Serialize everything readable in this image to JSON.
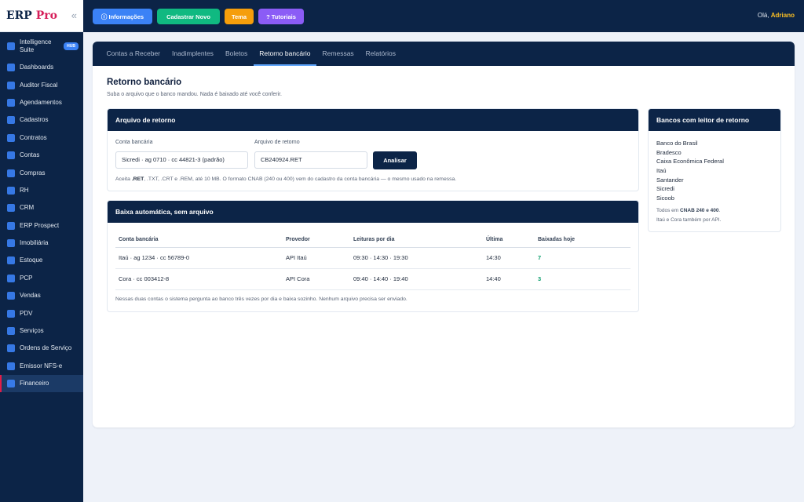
{
  "app": {
    "brand_main": "ERP",
    "brand_accent": "Pro",
    "collapse_icon": "«"
  },
  "sidebar": {
    "items": [
      {
        "label": "Intelligence Suite",
        "badge": "HUB"
      },
      {
        "label": "Dashboards"
      },
      {
        "label": "Auditor Fiscal"
      },
      {
        "label": "Agendamentos"
      },
      {
        "label": "Cadastros"
      },
      {
        "label": "Contratos"
      },
      {
        "label": "Contas"
      },
      {
        "label": "Compras"
      },
      {
        "label": "RH"
      },
      {
        "label": "CRM"
      },
      {
        "label": "ERP Prospect"
      },
      {
        "label": "Imobiliária"
      },
      {
        "label": "Estoque"
      },
      {
        "label": "PCP"
      },
      {
        "label": "Vendas"
      },
      {
        "label": "PDV"
      },
      {
        "label": "Serviços"
      },
      {
        "label": "Ordens de Serviço"
      },
      {
        "label": "Emissor NFS-e"
      },
      {
        "label": "Financeiro",
        "active": true
      }
    ]
  },
  "topbar": {
    "info": "ⓘ Informações",
    "new": "Cadastrar Novo",
    "theme": "Tema",
    "tutorials": "? Tutoriais",
    "greeting_prefix": "Olá,",
    "user": "Adriano"
  },
  "tabs": [
    "Contas a Receber",
    "Inadimplentes",
    "Boletos",
    "Retorno bancário",
    "Remessas",
    "Relatórios"
  ],
  "active_tab": "Retorno bancário",
  "page": {
    "title": "Retorno bancário",
    "subtitle": "Suba o arquivo que o banco mandou. Nada é baixado até você conferir."
  },
  "upload": {
    "header": "Arquivo de retorno",
    "account_label": "Conta bancária",
    "account_value": "Sicredi · ag 0710 · cc 44821-3  (padrão)",
    "file_label": "Arquivo de retorno",
    "file_value": "CB240924.RET",
    "analyze_button": "Analisar",
    "hint_prefix": "Aceita ",
    "hint_ext": ".RET",
    "hint_suffix": ", .TXT, .CRT e .REM, até 10 MB. O formato CNAB (240 ou 400) vem do cadastro da conta bancária — o mesmo usado na remessa."
  },
  "auto": {
    "header": "Baixa automática, sem arquivo",
    "columns": [
      "Conta bancária",
      "Provedor",
      "Leituras por dia",
      "Última",
      "Baixadas hoje"
    ],
    "rows": [
      {
        "account": "Itaú · ag 1234 · cc 56789-0",
        "provider": "API Itaú",
        "reads": "09:30 · 14:30 · 19:30",
        "last": "14:30",
        "count": "7"
      },
      {
        "account": "Cora · cc 003412-8",
        "provider": "API Cora",
        "reads": "09:40 · 14:40 · 19:40",
        "last": "14:40",
        "count": "3"
      }
    ],
    "note": "Nessas duas contas o sistema pergunta ao banco três vezes por dia e baixa sozinho. Nenhum arquivo precisa ser enviado."
  },
  "banks": {
    "header": "Bancos com leitor de retorno",
    "list": [
      "Banco do Brasil",
      "Bradesco",
      "Caixa Econômica Federal",
      "Itaú",
      "Santander",
      "Sicredi",
      "Sicoob"
    ],
    "foot_prefix": "Todos em ",
    "foot_bold": "CNAB 240 e 400",
    "foot_suffix": ".",
    "foot_line2": "Itaú e Cora também por API."
  },
  "colors": {
    "navy": "#0c2447",
    "accent_blue": "#3b82f6",
    "success": "#10b981",
    "warning": "#f59e0b",
    "violet": "#8b5cf6",
    "active_marker": "#e11d48",
    "user_highlight": "#fbbf24"
  }
}
